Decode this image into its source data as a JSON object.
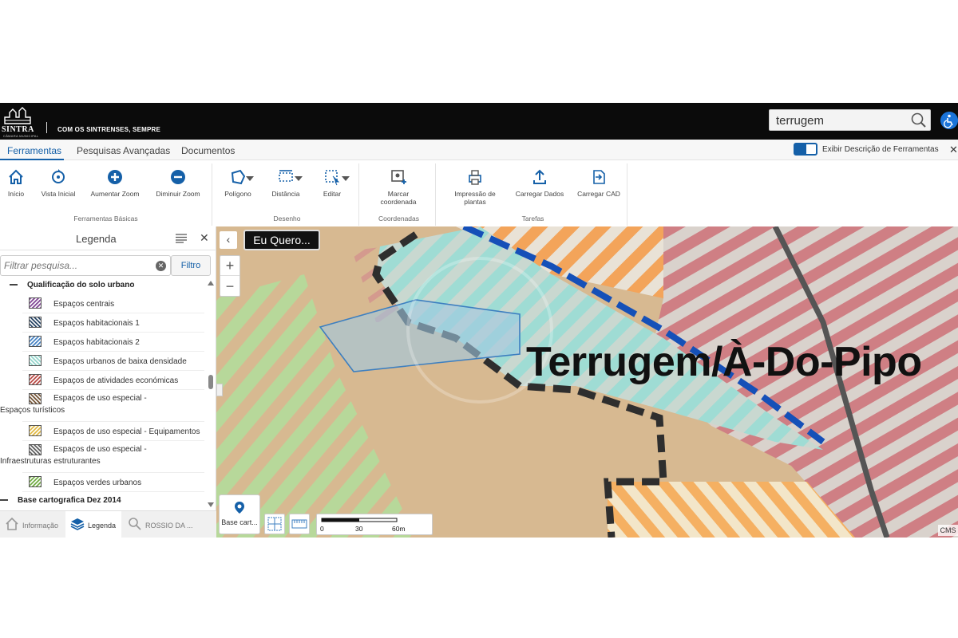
{
  "header": {
    "logo_text": "SINTRA",
    "logo_subtext": "CÂMARA MUNICIPAL",
    "slogan": "COM OS SINTRENSES, SEMPRE",
    "search_value": "terrugem",
    "colors": {
      "bg": "#0b0b0b",
      "accessibility": "#1a73d9"
    }
  },
  "menu": {
    "tabs": [
      {
        "label": "Ferramentas",
        "active": true
      },
      {
        "label": "Pesquisas Avançadas",
        "active": false
      },
      {
        "label": "Documentos",
        "active": false
      }
    ],
    "toggle_label": "Exibir Descrição de Ferramentas",
    "toggle_on": true,
    "close": "✕"
  },
  "ribbon": {
    "groups": [
      {
        "label": "Ferramentas Básicas",
        "tools": [
          "Início",
          "Vista Inicial",
          "Aumentar Zoom",
          "Diminuir Zoom"
        ]
      },
      {
        "label": "Desenho",
        "tools": [
          "Polígono",
          "Distância",
          "Editar"
        ]
      },
      {
        "label": "Coordenadas",
        "tools": [
          "Marcar coordenada"
        ]
      },
      {
        "label": "Tarefas",
        "tools": [
          "Impressão de plantas",
          "Carregar Dados",
          "Carregar CAD"
        ]
      }
    ],
    "accent": "#1560a8"
  },
  "legend": {
    "title": "Legenda",
    "filter_placeholder": "Filtrar pesquisa...",
    "filter_button": "Filtro",
    "section1": "Qualificação do solo urbano",
    "items": [
      {
        "label": "Espaços centrais",
        "color": "#7a3d8f"
      },
      {
        "label": "Espaços habitacionais 1",
        "color": "#1d3b5c"
      },
      {
        "label": "Espaços habitacionais 2",
        "color": "#3f7ec2"
      },
      {
        "label": "Espaços urbanos de baixa densidade",
        "color": "#8fd3c9"
      },
      {
        "label": "Espaços de atividades económicas",
        "color": "#b5413c"
      },
      {
        "label": "Espaços de uso especial - Espaços turísticos",
        "color": "#6b4a2a"
      },
      {
        "label": "Espaços de uso especial - Equipamentos",
        "color": "#e0b63b"
      },
      {
        "label": "Espaços de uso especial - Infraestruturas estruturantes",
        "color": "#555555"
      },
      {
        "label": "Espaços verdes urbanos",
        "color": "#6aa83a"
      }
    ],
    "section2": "Base cartografica Dez 2014"
  },
  "bottom_tabs": [
    {
      "label": "Informação",
      "active": false
    },
    {
      "label": "Legenda",
      "active": true
    },
    {
      "label": "ROSSIO DA ...",
      "active": false
    }
  ],
  "map": {
    "place_label": "Terrugem/À-Do-Pipo",
    "eu_quero": "Eu Quero...",
    "basemap_label": "Base cart...",
    "scale": {
      "ticks": [
        "0",
        "30",
        "60m"
      ]
    },
    "attribution": "CMS",
    "zoom_in": "+",
    "zoom_out": "−",
    "collapse": "‹"
  }
}
